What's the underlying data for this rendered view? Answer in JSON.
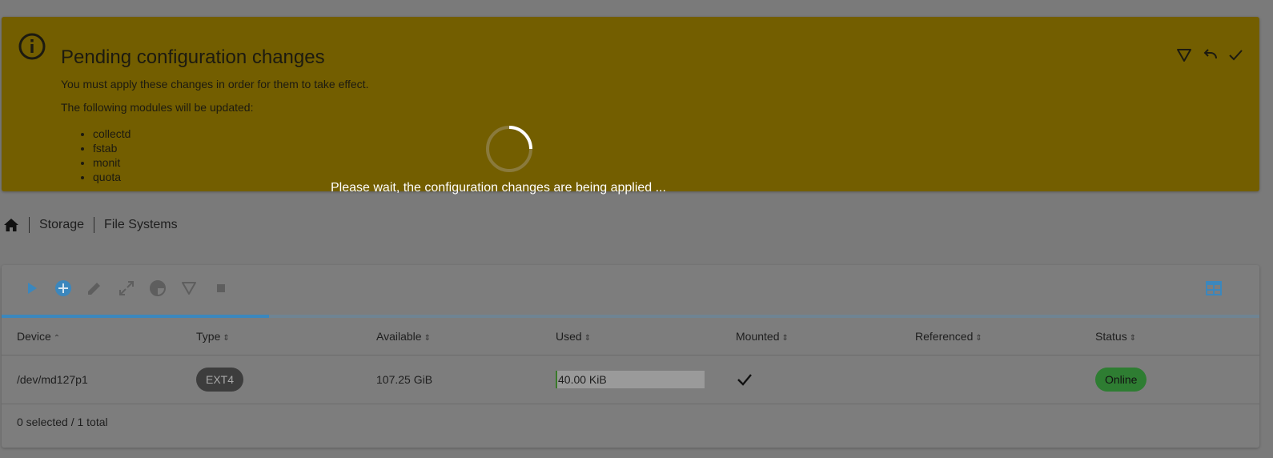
{
  "banner": {
    "title": "Pending configuration changes",
    "message": "You must apply these changes in order for them to take effect.",
    "modules_heading": "The following modules will be updated:",
    "modules": [
      "collectd",
      "fstab",
      "monit",
      "quota"
    ],
    "icons": [
      "info-icon",
      "filter-icon",
      "undo-icon",
      "check-icon"
    ],
    "background_color": "#735e00"
  },
  "overlay": {
    "wait_message": "Please wait, the configuration changes are being applied ..."
  },
  "breadcrumb": {
    "home_icon": "home-icon",
    "items": [
      "Storage",
      "File Systems"
    ]
  },
  "toolbar": {
    "icons": [
      "play-icon",
      "add-circle-icon",
      "edit-icon",
      "expand-icon",
      "pie-chart-icon",
      "filter-icon",
      "stop-icon",
      "table-layout-icon"
    ],
    "accent_color": "#3b87bd"
  },
  "table": {
    "columns": [
      {
        "label": "Device",
        "sort": "asc"
      },
      {
        "label": "Type",
        "sort": "none"
      },
      {
        "label": "Available",
        "sort": "none"
      },
      {
        "label": "Used",
        "sort": "none"
      },
      {
        "label": "Mounted",
        "sort": "none"
      },
      {
        "label": "Referenced",
        "sort": "none"
      },
      {
        "label": "Status",
        "sort": "none"
      }
    ],
    "rows": [
      {
        "device": "/dev/md127p1",
        "type": "EXT4",
        "available": "107.25 GiB",
        "used": "40.00 KiB",
        "used_fraction": 0.01,
        "mounted": true,
        "referenced": "",
        "status": "Online",
        "status_color": "#2e7d32"
      }
    ],
    "footer": "0 selected / 1 total"
  }
}
